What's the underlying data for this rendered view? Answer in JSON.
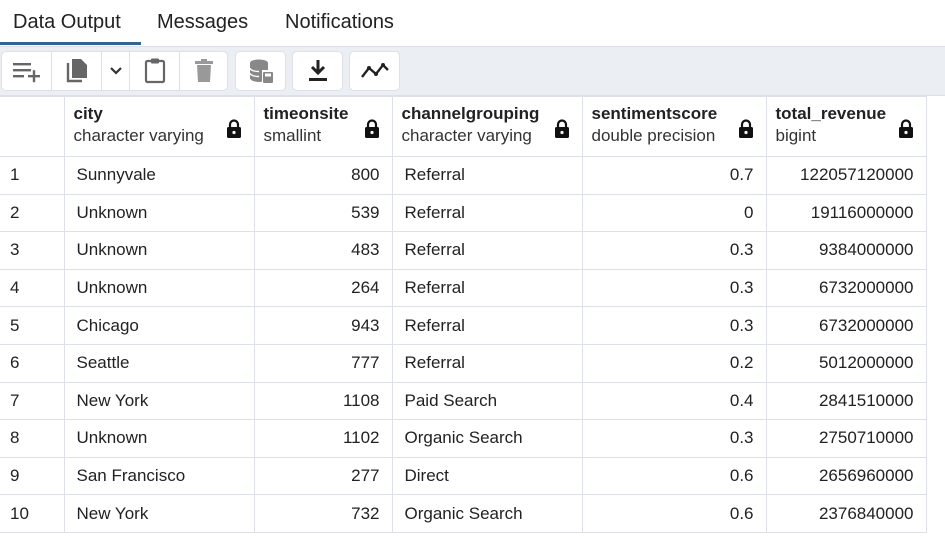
{
  "tabs": [
    {
      "label": "Data Output",
      "active": true
    },
    {
      "label": "Messages",
      "active": false
    },
    {
      "label": "Notifications",
      "active": false
    }
  ],
  "toolbar": {
    "buttons": [
      "add-row-icon",
      "copy-icon",
      "chevron-down-icon",
      "paste-icon",
      "delete-icon",
      "save-data-icon",
      "download-icon",
      "graph-icon"
    ]
  },
  "columns": [
    {
      "name": "city",
      "type": "character varying"
    },
    {
      "name": "timeonsite",
      "type": "smallint"
    },
    {
      "name": "channelgrouping",
      "type": "character varying"
    },
    {
      "name": "sentimentscore",
      "type": "double precision"
    },
    {
      "name": "total_revenue",
      "type": "bigint"
    }
  ],
  "rows": [
    {
      "n": "1",
      "city": "Sunnyvale",
      "timeonsite": "800",
      "channelgrouping": "Referral",
      "sentimentscore": "0.7",
      "total_revenue": "122057120000"
    },
    {
      "n": "2",
      "city": "Unknown",
      "timeonsite": "539",
      "channelgrouping": "Referral",
      "sentimentscore": "0",
      "total_revenue": "19116000000"
    },
    {
      "n": "3",
      "city": "Unknown",
      "timeonsite": "483",
      "channelgrouping": "Referral",
      "sentimentscore": "0.3",
      "total_revenue": "9384000000"
    },
    {
      "n": "4",
      "city": "Unknown",
      "timeonsite": "264",
      "channelgrouping": "Referral",
      "sentimentscore": "0.3",
      "total_revenue": "6732000000"
    },
    {
      "n": "5",
      "city": "Chicago",
      "timeonsite": "943",
      "channelgrouping": "Referral",
      "sentimentscore": "0.3",
      "total_revenue": "6732000000"
    },
    {
      "n": "6",
      "city": "Seattle",
      "timeonsite": "777",
      "channelgrouping": "Referral",
      "sentimentscore": "0.2",
      "total_revenue": "5012000000"
    },
    {
      "n": "7",
      "city": "New York",
      "timeonsite": "1108",
      "channelgrouping": "Paid Search",
      "sentimentscore": "0.4",
      "total_revenue": "2841510000"
    },
    {
      "n": "8",
      "city": "Unknown",
      "timeonsite": "1102",
      "channelgrouping": "Organic Search",
      "sentimentscore": "0.3",
      "total_revenue": "2750710000"
    },
    {
      "n": "9",
      "city": "San Francisco",
      "timeonsite": "277",
      "channelgrouping": "Direct",
      "sentimentscore": "0.6",
      "total_revenue": "2656960000"
    },
    {
      "n": "10",
      "city": "New York",
      "timeonsite": "732",
      "channelgrouping": "Organic Search",
      "sentimentscore": "0.6",
      "total_revenue": "2376840000"
    }
  ],
  "colors": {
    "accent": "#326690",
    "toolbar_bg": "#ebeef3",
    "border": "#dde0e6"
  }
}
